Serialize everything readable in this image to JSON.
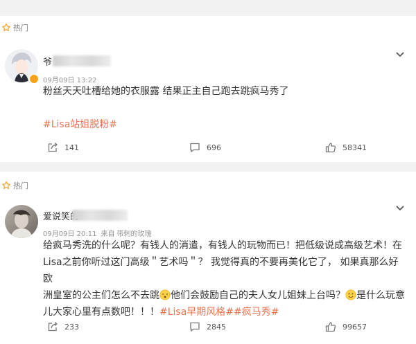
{
  "colors": {
    "accent": "#eb7350",
    "badge": "#f6a31b",
    "muted": "#939393"
  },
  "posts": [
    {
      "section_label": "热门",
      "author_visible": "爷",
      "time": "09月09日 13:22",
      "lines": [
        "粉丝天天吐槽给她的衣服露 结果正主自己跑去跳疯马秀了"
      ],
      "tag": "#Lisa站姐脱粉#",
      "repost_count": "141",
      "comment_count": "696",
      "like_count": "58341"
    },
    {
      "section_label": "热门",
      "author_visible": "爱说笑的",
      "time": "09月09日 20:11",
      "source_prefix": "来自",
      "source": "带刺的玫瑰",
      "line1": "给疯马秀洗的什么呢？有钱人的消遣，有钱人的玩物而已！把低级说成高级艺术！在",
      "line2": "Lisa之前你听过这门高级＂艺术吗＂？ 我觉得真的不要再美化它了， 如果真那么好 欧",
      "line3_a": "洲皇室的公主们怎么不去跳",
      "line3_b": "他们会鼓励自己的夫人女儿姐妹上台吗？",
      "line3_c": "是什么玩意",
      "line4_a": "儿大家心里有点数吧！！！",
      "tags": "#Lisa早期风格##疯马秀#",
      "repost_count": "233",
      "comment_count": "2845",
      "like_count": "99657"
    }
  ]
}
